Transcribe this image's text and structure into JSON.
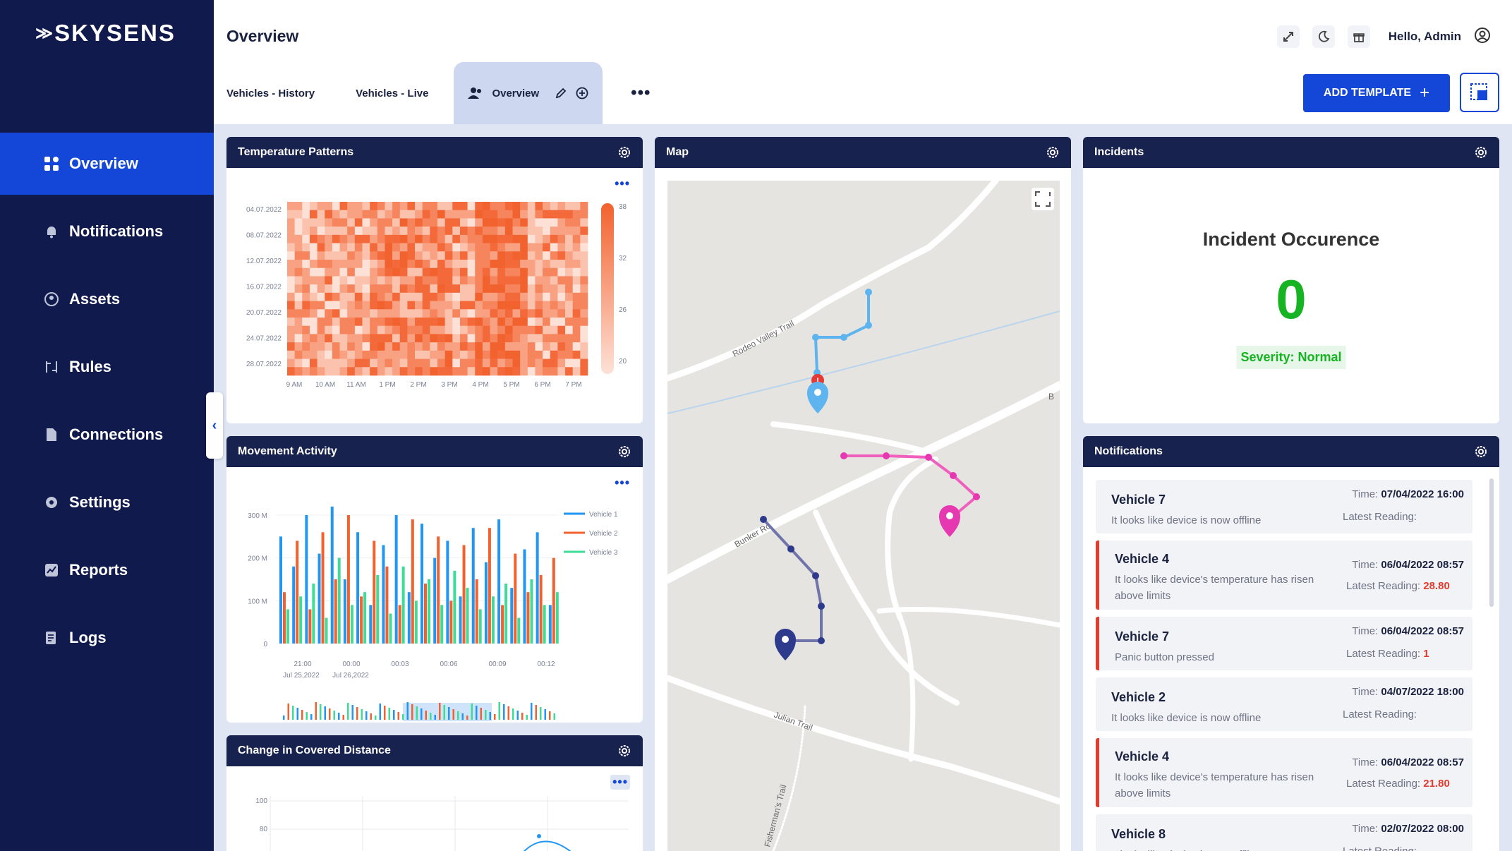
{
  "app": {
    "logo_text": "SKYSENS"
  },
  "sidebar": {
    "items": [
      {
        "label": "Overview",
        "icon": "grid-icon",
        "active": true
      },
      {
        "label": "Notifications",
        "icon": "bell-icon"
      },
      {
        "label": "Assets",
        "icon": "location-icon"
      },
      {
        "label": "Rules",
        "icon": "rules-icon"
      },
      {
        "label": "Connections",
        "icon": "file-icon"
      },
      {
        "label": "Settings",
        "icon": "gear-icon"
      },
      {
        "label": "Reports",
        "icon": "chart-icon"
      },
      {
        "label": "Logs",
        "icon": "log-icon"
      }
    ]
  },
  "header": {
    "title": "Overview",
    "greeting": "Hello, Admin",
    "icons": [
      "expand-icon",
      "moon-icon",
      "gift-icon",
      "user-circle-icon"
    ]
  },
  "tabs": {
    "items": [
      "Vehicles - History",
      "Vehicles - Live",
      "Overview"
    ],
    "active": "Overview",
    "more": "•••",
    "add_template_label": "ADD TEMPLATE"
  },
  "cards": {
    "temperature": {
      "title": "Temperature Patterns",
      "more": "•••"
    },
    "movement": {
      "title": "Movement Activity",
      "more": "•••"
    },
    "distance": {
      "title": "Change in Covered Distance",
      "more": "•••"
    },
    "map": {
      "title": "Map"
    },
    "incidents": {
      "title": "Incidents",
      "heading": "Incident Occurence",
      "count": "0",
      "severity": "Severity: Normal"
    },
    "notifications": {
      "title": "Notifications"
    }
  },
  "map_labels": [
    "Rodeo Valley Trail",
    "Bunker Rd",
    "Julian Trail",
    "Fisherman's Trail",
    "B"
  ],
  "notifications": [
    {
      "vehicle": "Vehicle 7",
      "message": "It looks like device is now offline",
      "time": "07/04/2022 16:00",
      "reading": "",
      "alert": false
    },
    {
      "vehicle": "Vehicle 4",
      "message": "It looks like device's temperature has risen above limits",
      "time": "06/04/2022 08:57",
      "reading": "28.80",
      "alert": true
    },
    {
      "vehicle": "Vehicle 7",
      "message": "Panic button pressed",
      "time": "06/04/2022 08:57",
      "reading": "1",
      "alert": true
    },
    {
      "vehicle": "Vehicle 2",
      "message": "It looks like device is now offline",
      "time": "04/07/2022 18:00",
      "reading": "",
      "alert": false
    },
    {
      "vehicle": "Vehicle 4",
      "message": "It looks like device's temperature has risen above limits",
      "time": "06/04/2022 08:57",
      "reading": "21.80",
      "alert": true
    },
    {
      "vehicle": "Vehicle 8",
      "message": "It looks like device is now offline",
      "time": "02/07/2022 08:00",
      "reading": "",
      "alert": false
    }
  ],
  "notif_labels": {
    "time_prefix": "Time:",
    "reading_prefix": "Latest Reading:"
  },
  "colors": {
    "sidebar": "#101a4d",
    "accent": "#1447d8",
    "card_head": "#17224f",
    "alert": "#e33b2d",
    "success": "#17b322"
  },
  "chart_data": [
    {
      "type": "heatmap",
      "title": "Temperature Patterns",
      "y_categories": [
        "04.07.2022",
        "08.07.2022",
        "12.07.2022",
        "16.07.2022",
        "20.07.2022",
        "24.07.2022",
        "28.07.2022"
      ],
      "x_categories": [
        "9 AM",
        "10 AM",
        "11 AM",
        "1 PM",
        "2 PM",
        "3 PM",
        "4 PM",
        "5 PM",
        "6 PM",
        "7 PM"
      ],
      "color_scale": {
        "min": 20,
        "max": 38,
        "ticks": [
          "38",
          "32",
          "26",
          "20"
        ]
      }
    },
    {
      "type": "bar",
      "title": "Movement Activity",
      "y_ticks": [
        "300 M",
        "200 M",
        "100 M",
        "0"
      ],
      "ylim": [
        0,
        300
      ],
      "x_ticks": [
        "21:00",
        "00:00",
        "00:03",
        "00:06",
        "00:09",
        "00:12"
      ],
      "x_subticks": [
        "Jul 25,2022",
        "Jul 26,2022"
      ],
      "series": [
        {
          "name": "Vehicle 1",
          "color": "#2196f3",
          "values": [
            250,
            180,
            300,
            210,
            320,
            150,
            260,
            90,
            230,
            300,
            120,
            280,
            200,
            240,
            110,
            270,
            190,
            290,
            130,
            220,
            260,
            90
          ]
        },
        {
          "name": "Vehicle 2",
          "color": "#f2622e",
          "values": [
            120,
            240,
            80,
            260,
            150,
            300,
            110,
            240,
            180,
            90,
            290,
            140,
            250,
            100,
            230,
            150,
            270,
            90,
            210,
            120,
            160,
            200
          ]
        },
        {
          "name": "Vehicle 3",
          "color": "#3ddc97",
          "values": [
            80,
            110,
            140,
            60,
            200,
            90,
            120,
            160,
            70,
            180,
            100,
            150,
            90,
            170,
            130,
            80,
            110,
            140,
            60,
            150,
            90,
            120
          ]
        }
      ]
    },
    {
      "type": "line",
      "title": "Change in Covered Distance",
      "y_ticks": [
        "100",
        "80"
      ]
    }
  ]
}
